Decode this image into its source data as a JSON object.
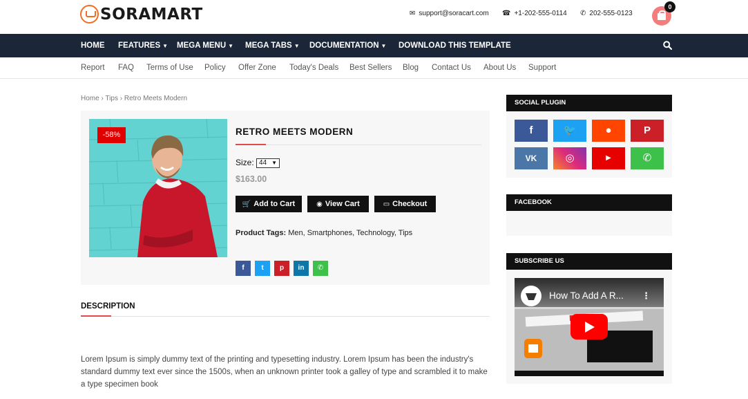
{
  "brand": {
    "name": "SORAMART",
    "accent": "#f36c21"
  },
  "header": {
    "email": "support@soracart.com",
    "phone": "+1-202-555-0114",
    "whatsapp": "202-555-0123",
    "cart_count": "0"
  },
  "main_nav": [
    {
      "label": "HOME"
    },
    {
      "label": "FEATURES"
    },
    {
      "label": "MEGA MENU"
    },
    {
      "label": "MEGA TABS"
    },
    {
      "label": "DOCUMENTATION"
    },
    {
      "label": "DOWNLOAD THIS TEMPLATE"
    }
  ],
  "sub_nav": [
    "Report",
    "FAQ",
    "Terms of Use",
    "Policy",
    "Offer Zone",
    "Today's Deals",
    "Best Sellers",
    "Blog",
    "Contact Us",
    "About Us",
    "Support"
  ],
  "breadcrumb": {
    "home": "Home",
    "sep": "›",
    "category": "Tips",
    "current": "Retro Meets Modern"
  },
  "product": {
    "discount": "-58%",
    "title": "RETRO MEETS MODERN",
    "size_label": "Size:",
    "size_value": "44",
    "price": "$163.00",
    "buttons": {
      "add_to_cart": "Add to Cart",
      "view_cart": "View Cart",
      "checkout": "Checkout"
    },
    "tags_label": "Product Tags:",
    "tags": "Men, Smartphones, Technology, Tips"
  },
  "description": {
    "tab": "DESCRIPTION",
    "text": "Lorem Ipsum is simply dummy text of the printing and typesetting industry. Lorem Ipsum has been the industry's standard dummy text ever since the 1500s, when an unknown printer took a galley of type and scrambled it to make a type specimen book"
  },
  "sidebar": {
    "social_title": "SOCIAL PLUGIN",
    "facebook_title": "FACEBOOK",
    "subscribe_title": "SUBSCRIBE US",
    "video_title": "How To Add A R..."
  },
  "colors": {
    "nav_bg": "#1b2639",
    "facebook": "#3b5998",
    "twitter": "#1da1f2",
    "reddit": "#ff4500",
    "pinterest": "#cb2027",
    "vk": "#4a76a8",
    "youtube": "#e60000",
    "whatsapp": "#3ec14a",
    "linkedin": "#0e76a8"
  }
}
